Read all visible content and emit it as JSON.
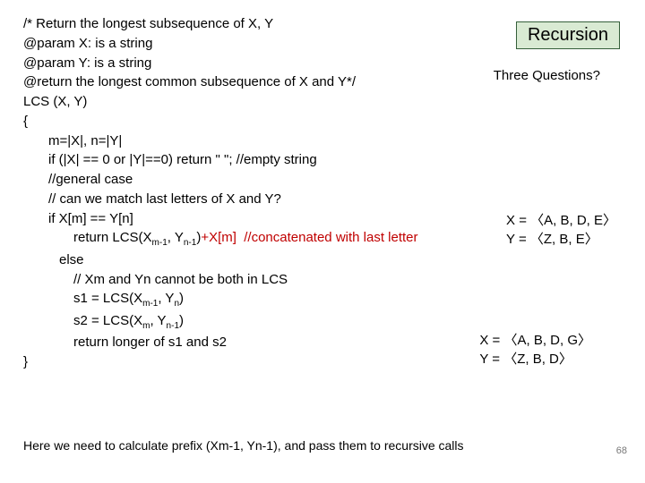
{
  "code": {
    "l1": "/* Return the longest subsequence of X, Y",
    "l2": "@param X: is a string",
    "l3": "@param Y: is a string",
    "l4": "@return the longest common subsequence of X and Y*/",
    "l5": "LCS (X, Y)",
    "l6": "{",
    "l7": "m=|X|, n=|Y|",
    "l8": "if (|X| == 0 or |Y|==0) return \" \"; //empty string",
    "l9": "//general case",
    "l10": "// can we match last letters of X and Y?",
    "l11": "if X[m] == Y[n]",
    "l12a": "return LCS(X",
    "l12sub1": "m-1",
    "l12b": ", Y",
    "l12sub2": "n-1",
    "l12c": ")",
    "l12red": "+X[m]  //concatenated with last letter",
    "l13": "else",
    "l14": "// Xm and Yn cannot be both in LCS",
    "l15a": "s1 = LCS(X",
    "l15sub": "m-1",
    "l15b": ", Y",
    "l15sub2": "n",
    "l15c": ")",
    "l16a": "s2 = LCS(X",
    "l16sub": "m",
    "l16b": ", Y",
    "l16sub2": "n-1",
    "l16c": ")",
    "l17": "return longer of s1 and s2",
    "l18": "}"
  },
  "recursion_label": "Recursion",
  "three_questions": "Three Questions?",
  "example1": {
    "x": "X = 〈A, B, D, E〉",
    "y": "Y = 〈Z, B, E〉"
  },
  "example2": {
    "x": "X = 〈A, B, D, G〉",
    "y": "Y = 〈Z, B, D〉"
  },
  "footer": "Here we need to calculate prefix (Xm-1, Yn-1), and pass them to recursive calls",
  "page_number": "68"
}
